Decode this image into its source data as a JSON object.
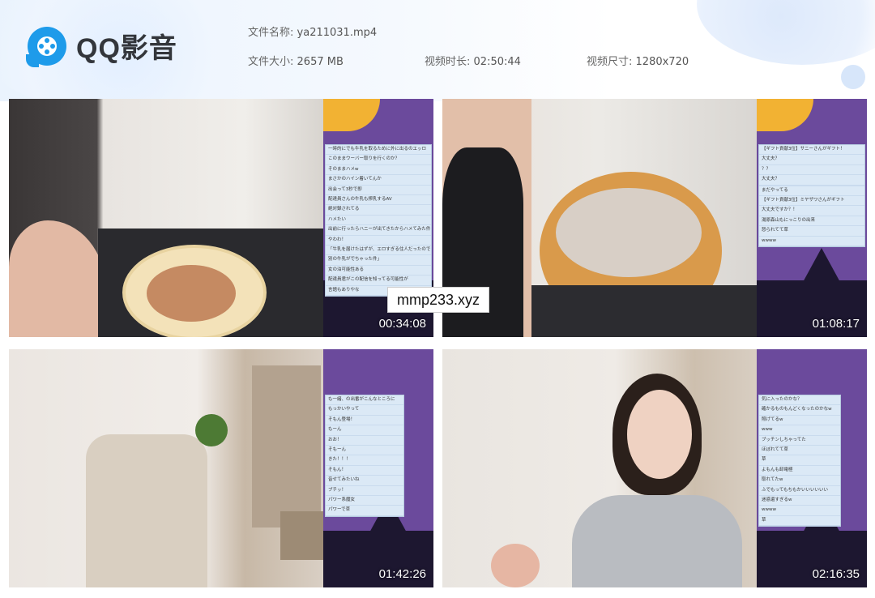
{
  "app": {
    "logo_text": "QQ影音"
  },
  "file_info": {
    "name_label": "文件名称:",
    "name_value": "ya211031.mp4",
    "size_label": "文件大小:",
    "size_value": "2657 MB",
    "duration_label": "视频时长:",
    "duration_value": "02:50:44",
    "resolution_label": "视频尺寸:",
    "resolution_value": "1280x720"
  },
  "watermark": "mmp233.xyz",
  "thumbnails": [
    {
      "timestamp": "00:34:08",
      "chat": [
        "一時的にでも牛乳を取るために外に出るのエッロ",
        "このままウーバー取りを行くのか？",
        "そのままハメw",
        "まさかのハイン着いてんか",
        "出会って3秒で即",
        "配達員さんの牛乳も搾乳するAV",
        "絶対録されてる",
        "ハメたい",
        "出前に行ったらハニーが出てきたからハメてみた件",
        "やわわ！",
        "「牛乳を届けたはずが、エロすぎる住人だったので",
        "別の牛乳がでちゃった件」",
        "女の泊可能性ある",
        "配達員君がこの配信を知ってる可能性が",
        "言語もありやな"
      ]
    },
    {
      "timestamp": "01:08:17",
      "chat": [
        "【ギフト貢献3位】サニーさんがギフト！",
        "大丈夫？",
        "？？",
        "大丈夫？",
        "",
        "まだやってる",
        "【ギフト貢献3位】ミヤザワさんがギフト",
        "大丈夫ですか？！",
        "湯原森山もにっこりの出来",
        "怒られてて草",
        "wwww"
      ]
    },
    {
      "timestamp": "01:42:26",
      "chat": [
        "も一緒、の出番がこんなところに",
        "もっかいやって",
        "そもん登場！",
        "もーん",
        "おお！",
        "そもーん",
        "きた！！！",
        "そもん！",
        "音せてみたいね",
        "ブチッ！",
        "パワー系魔女",
        "パワーで草"
      ]
    },
    {
      "timestamp": "02:16:35",
      "chat": [
        "気に入ったのかな？",
        "確かるものもんどくなったのかなw",
        "照げてるw",
        "www",
        "ブッチンしちゃってた",
        "ほぼれてて草",
        "草",
        "よもんも卸電極",
        "取れてたw",
        "ふでもってもちもかいいいいいい",
        "迷惑還すぎるw",
        "wwww",
        "草"
      ]
    }
  ]
}
